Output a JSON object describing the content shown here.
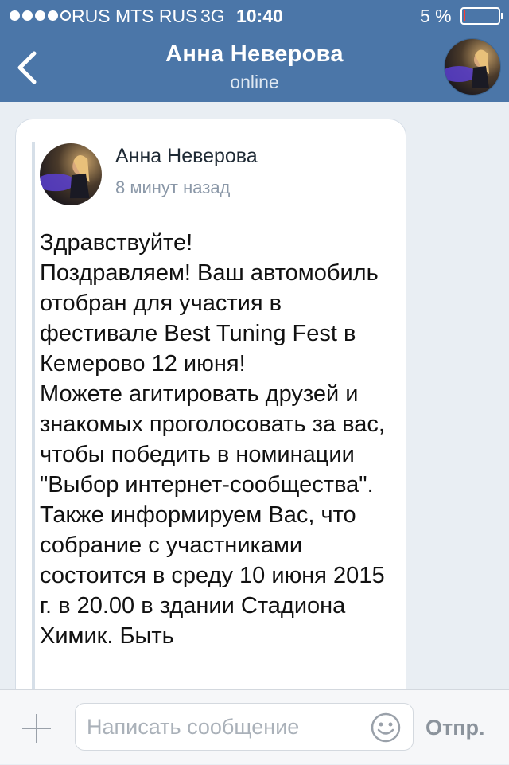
{
  "status_bar": {
    "carrier": "RUS MTS RUS",
    "network": "3G",
    "time": "10:40",
    "battery": "5 %",
    "battery_level_percent": 5
  },
  "header": {
    "back_icon": "chevron-left-icon",
    "contact_name": "Анна Неверова",
    "contact_status": "online",
    "avatar_icon": "contact-avatar"
  },
  "message": {
    "author": "Анна Неверова",
    "time": "8 минут назад",
    "text": "Здравствуйте!\nПоздравляем! Ваш автомобиль отобран для участия в фестивале Best Tuning Fest в Кемерово 12 июня!\nМожете агитировать друзей и знакомых проголосовать за вас, чтобы победить в номинации \"Выбор интернет-сообщества\".\nТакже информируем Вас, что собрание с участниками состоится в среду 10 июня 2015 г. в 20.00 в здании Стадиона Химик. Быть"
  },
  "input_bar": {
    "attach_icon": "plus-icon",
    "placeholder": "Написать сообщение",
    "emoji_icon": "smile-icon",
    "send_label": "Отпр."
  },
  "colors": {
    "header_bg": "#4b76a8",
    "page_bg": "#e9eef3",
    "battery_low": "#ff3b30"
  }
}
